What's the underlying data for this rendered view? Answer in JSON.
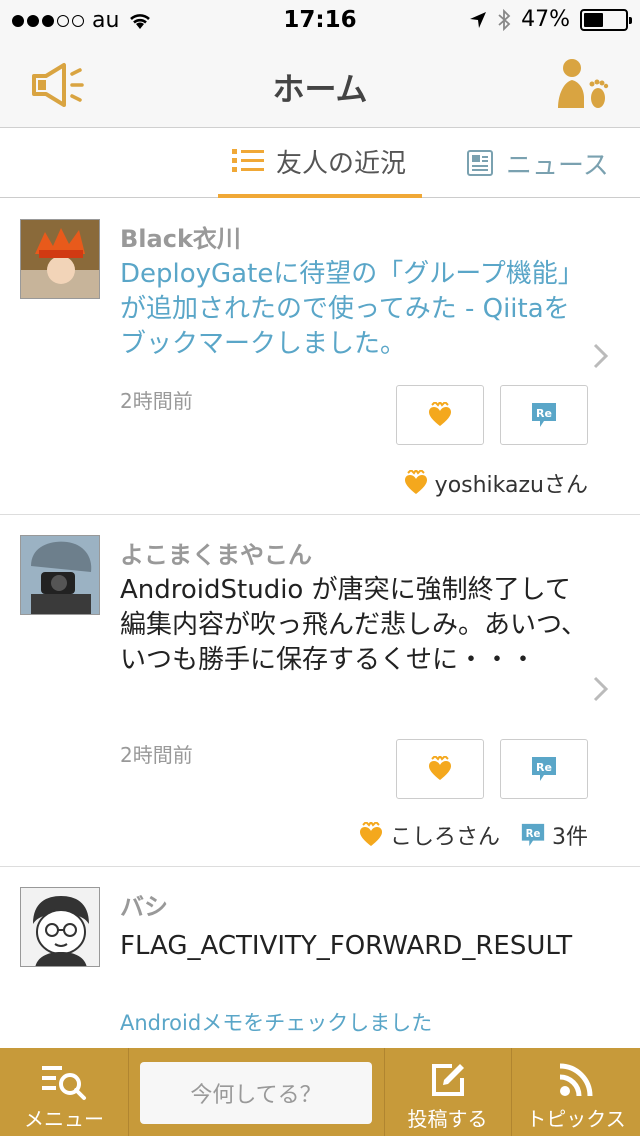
{
  "status": {
    "carrier": "au",
    "time": "17:16",
    "battery": "47%",
    "battery_level": 0.47
  },
  "nav": {
    "title": "ホーム"
  },
  "tabs": [
    {
      "label": "友人の近況",
      "active": true
    },
    {
      "label": "ニュース",
      "active": false
    }
  ],
  "posts": [
    {
      "user": "Black衣川",
      "text": "DeployGateに待望の「グループ機能」が追加されたので使ってみた - Qiitaをブックマークしました。",
      "time": "2時間前",
      "reaction_user": "yoshikazuさん",
      "reply_count": ""
    },
    {
      "user": "よこまくまやこん",
      "text": "AndroidStudio が唐突に強制終了して編集内容が吹っ飛んだ悲しみ。あいつ、いつも勝手に保存するくせに・・・",
      "time": "2時間前",
      "reaction_user": "こしろさん",
      "reply_count": "3件"
    },
    {
      "user": "バシ",
      "text": "FLAG_ACTIVITY_FORWARD_RESULT",
      "sub": "Androidメモをチェックしました"
    }
  ],
  "bottom": {
    "menu": "メニュー",
    "compose_placeholder": "今何してる？",
    "post": "投稿する",
    "topics": "トピックス"
  },
  "colors": {
    "accent": "#f0a836",
    "bar": "#c79a3a",
    "link": "#5aa6c8"
  }
}
